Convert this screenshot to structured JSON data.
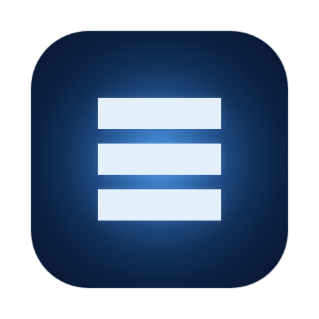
{
  "icon": {
    "name": "menu-icon",
    "accent_color": "#e4effc",
    "background_colors": [
      "#4f95dc",
      "#081733"
    ]
  }
}
